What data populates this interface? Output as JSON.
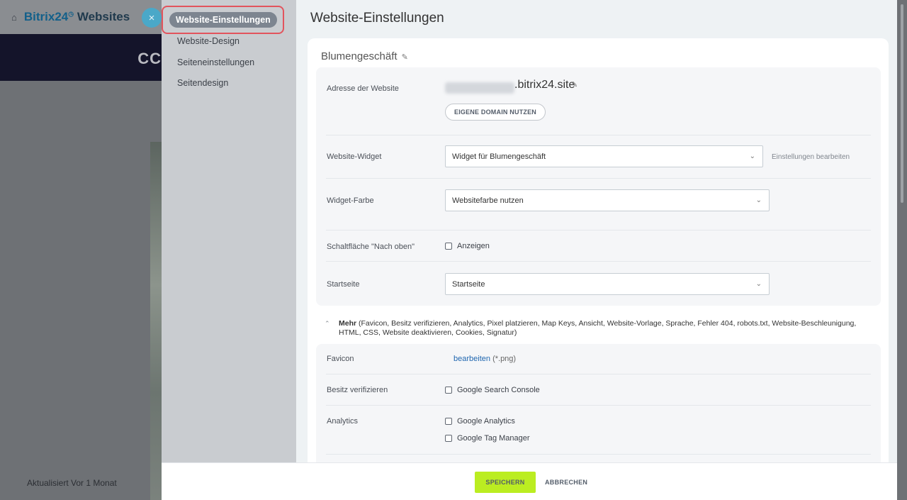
{
  "background": {
    "app_name_b24": "Bitrix24",
    "app_name_web": "Websites",
    "band_text": "CC",
    "updated": "Aktualisiert Vor 1 Monat"
  },
  "close_label": "×",
  "nav": {
    "active": "Website-Einstellungen",
    "items": [
      "Website-Design",
      "Seiteneinstellungen",
      "Seitendesign"
    ]
  },
  "page_title": "Website-Einstellungen",
  "site_name": "Blumengeschäft",
  "address": {
    "label": "Adresse der Website",
    "domain": ".bitrix24.site",
    "own_domain_button": "EIGENE DOMAIN NUTZEN"
  },
  "widget": {
    "label": "Website-Widget",
    "value": "Widget für Blumengeschäft",
    "edit_link": "Einstellungen bearbeiten"
  },
  "widget_color": {
    "label": "Widget-Farbe",
    "value": "Websitefarbe nutzen"
  },
  "back_to_top": {
    "label": "Schaltfläche \"Nach oben\"",
    "option": "Anzeigen"
  },
  "startpage": {
    "label": "Startseite",
    "value": "Startseite"
  },
  "more": {
    "title": "Mehr",
    "details": "(Favicon, Besitz verifizieren, Analytics, Pixel platzieren, Map Keys, Ansicht, Website-Vorlage, Sprache, Fehler 404, robots.txt, Website-Beschleunigung, HTML, CSS, Website deaktivieren, Cookies, Signatur)"
  },
  "favicon": {
    "label": "Favicon",
    "link": "bearbeiten",
    "hint": "(*.png)"
  },
  "verify": {
    "label": "Besitz verifizieren",
    "option": "Google Search Console"
  },
  "analytics": {
    "label": "Analytics",
    "options": [
      "Google Analytics",
      "Google Tag Manager"
    ]
  },
  "footer": {
    "save": "SPEICHERN",
    "cancel": "ABBRECHEN"
  },
  "colors": {
    "accent_green": "#bbed21",
    "highlight_red": "#e2545d",
    "link_blue": "#2067b0"
  }
}
